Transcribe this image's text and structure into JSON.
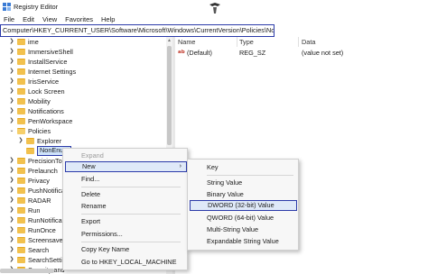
{
  "window": {
    "title": "Registry Editor",
    "app_icon": "regedit-icon"
  },
  "menubar": {
    "items": [
      "File",
      "Edit",
      "View",
      "Favorites",
      "Help"
    ]
  },
  "address": {
    "path": "Computer\\HKEY_CURRENT_USER\\Software\\Microsoft\\Windows\\CurrentVersion\\Policies\\NonEnum"
  },
  "tree": {
    "items": [
      {
        "label": "ime",
        "expanded": false,
        "selected": false
      },
      {
        "label": "ImmersiveShell",
        "expanded": false,
        "selected": false
      },
      {
        "label": "InstallService",
        "expanded": false,
        "selected": false
      },
      {
        "label": "Internet Settings",
        "expanded": false,
        "selected": false
      },
      {
        "label": "IrisService",
        "expanded": false,
        "selected": false
      },
      {
        "label": "Lock Screen",
        "expanded": false,
        "selected": false
      },
      {
        "label": "Mobility",
        "expanded": false,
        "selected": false
      },
      {
        "label": "Notifications",
        "expanded": false,
        "selected": false
      },
      {
        "label": "PenWorkspace",
        "expanded": false,
        "selected": false
      },
      {
        "label": "Policies",
        "expanded": true,
        "selected": false
      },
      {
        "label": "Explorer",
        "expanded": false,
        "selected": false
      },
      {
        "label": "NonEnum",
        "expanded": false,
        "selected": true
      },
      {
        "label": "PrecisionTouc",
        "expanded": false,
        "selected": false
      },
      {
        "label": "Prelaunch",
        "expanded": false,
        "selected": false
      },
      {
        "label": "Privacy",
        "expanded": false,
        "selected": false
      },
      {
        "label": "PushNotificati",
        "expanded": false,
        "selected": false
      },
      {
        "label": "RADAR",
        "expanded": false,
        "selected": false
      },
      {
        "label": "Run",
        "expanded": false,
        "selected": false
      },
      {
        "label": "RunNotificatio",
        "expanded": false,
        "selected": false
      },
      {
        "label": "RunOnce",
        "expanded": false,
        "selected": false
      },
      {
        "label": "Screensavers",
        "expanded": false,
        "selected": false
      },
      {
        "label": "Search",
        "expanded": false,
        "selected": false
      },
      {
        "label": "SearchSettings",
        "expanded": false,
        "selected": false
      },
      {
        "label": "Security and",
        "expanded": false,
        "selected": false
      }
    ]
  },
  "values_pane": {
    "columns": [
      "Name",
      "Type",
      "Data"
    ],
    "rows": [
      {
        "name": "(Default)",
        "type": "REG_SZ",
        "data": "(value not set)",
        "icon": "string-value-icon"
      }
    ]
  },
  "context_menu": {
    "items": [
      {
        "label": "Expand",
        "disabled": true
      },
      {
        "label": "New",
        "has_submenu": true,
        "highlighted": true
      },
      {
        "label": "Find..."
      },
      {
        "label": "Delete"
      },
      {
        "label": "Rename"
      },
      {
        "label": "Export"
      },
      {
        "label": "Permissions..."
      },
      {
        "label": "Copy Key Name"
      },
      {
        "label": "Go to HKEY_LOCAL_MACHINE"
      }
    ]
  },
  "new_submenu": {
    "items": [
      {
        "label": "Key"
      },
      {
        "label": "String Value"
      },
      {
        "label": "Binary Value"
      },
      {
        "label": "DWORD (32-bit) Value",
        "highlighted": true
      },
      {
        "label": "QWORD (64-bit) Value"
      },
      {
        "label": "Multi-String Value"
      },
      {
        "label": "Expandable String Value"
      }
    ]
  },
  "colors": {
    "highlight_border": "#2b3aa9",
    "folder": "#f2c14e",
    "selection_bg": "#cfe3fb"
  }
}
